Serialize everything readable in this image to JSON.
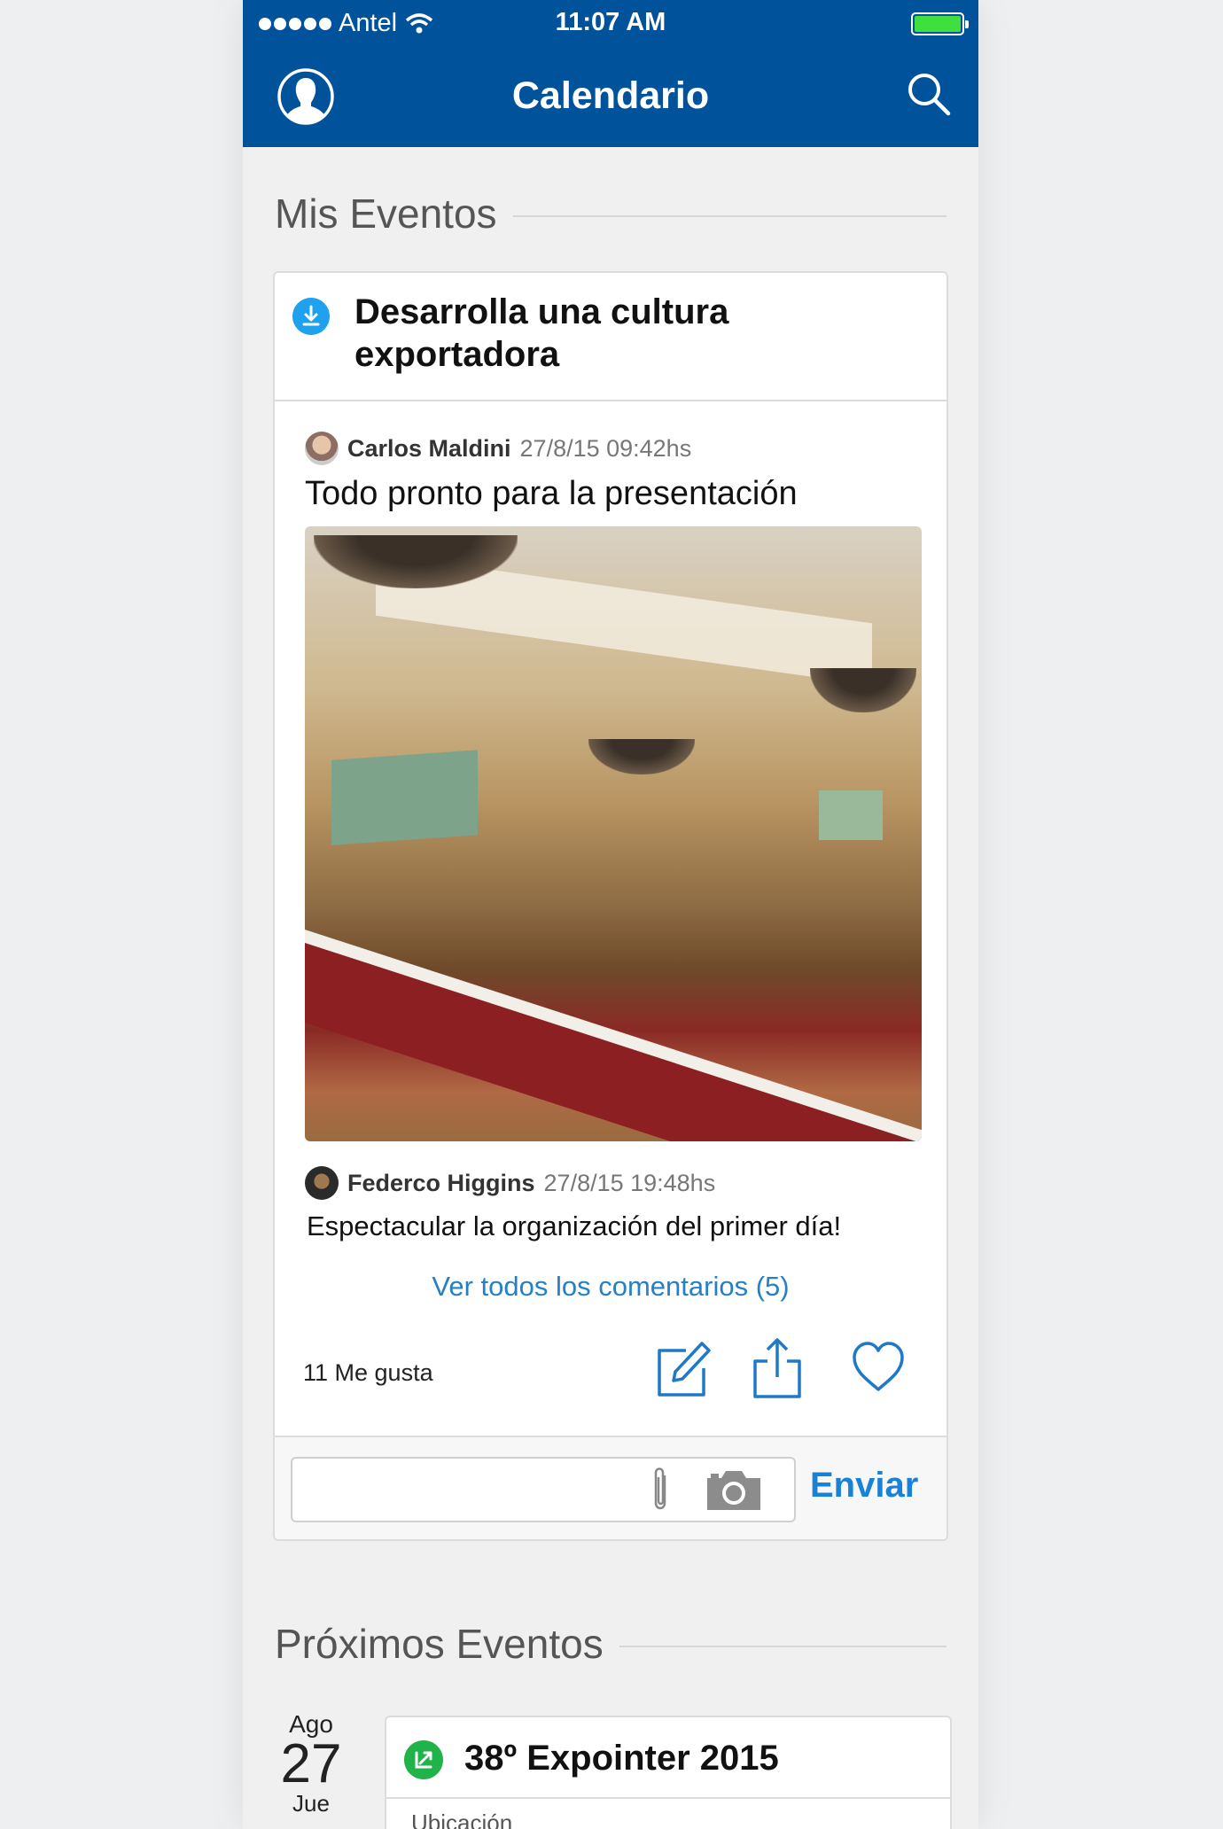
{
  "status_bar": {
    "carrier": "Antel",
    "time": "11:07 AM"
  },
  "nav": {
    "title": "Calendario"
  },
  "mis_eventos": {
    "section_title": "Mis Eventos",
    "event_title": "Desarrolla una cultura exportadora",
    "post": {
      "author": "Carlos Maldini",
      "timestamp": "27/8/15 09:42hs",
      "text": "Todo pronto para la presentación"
    },
    "comment": {
      "author": "Federco Higgins",
      "timestamp": "27/8/15 19:48hs",
      "text": "Espectacular la organización del primer día!"
    },
    "view_all_comments": "Ver todos los comentarios (5)",
    "likes": "11 Me gusta",
    "composer": {
      "placeholder": "",
      "send_label": "Enviar"
    }
  },
  "proximos_eventos": {
    "section_title": "Próximos Eventos",
    "event": {
      "month": "Ago",
      "day": "27",
      "weekday": "Jue",
      "title": "38º Expointer 2015",
      "subtitle": "Ubicación"
    }
  },
  "colors": {
    "nav_bg": "#00529b",
    "link": "#2581c4",
    "send": "#1a82d6",
    "badge_blue": "#1ea1ef",
    "badge_green": "#1fb34a",
    "icon_blue": "#1f78c8"
  }
}
